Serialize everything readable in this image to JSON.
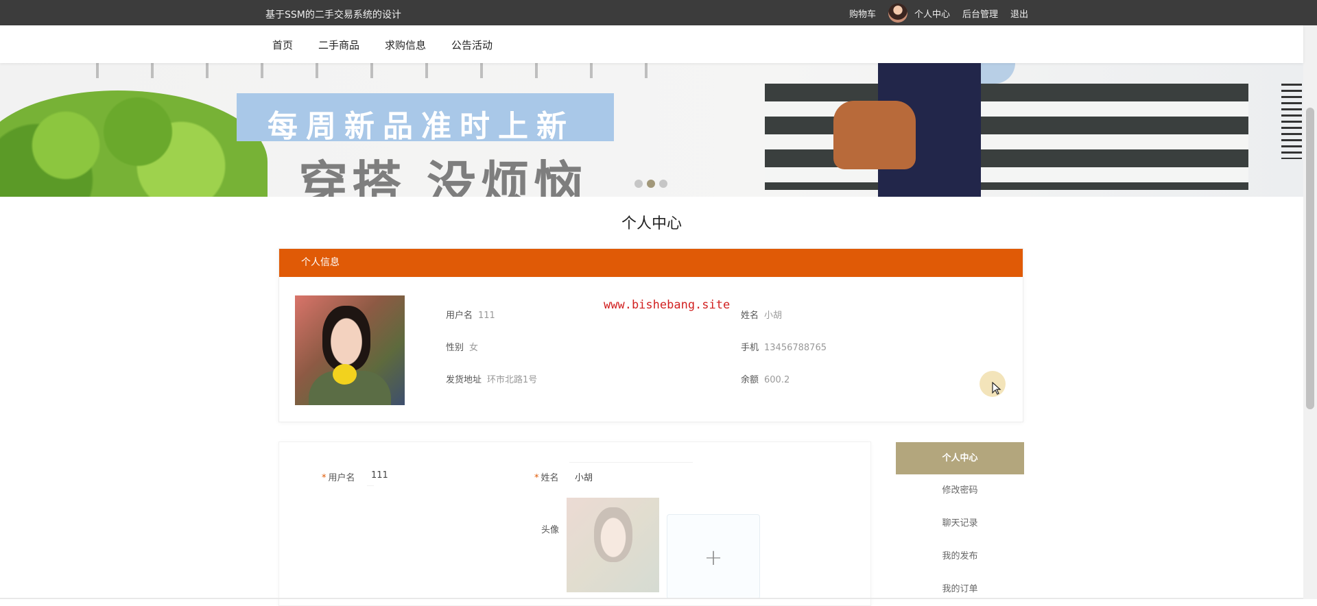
{
  "topbar": {
    "site_title": "基于SSM的二手交易系统的设计",
    "cart": "购物车",
    "user_center": "个人中心",
    "admin": "后台管理",
    "logout": "退出"
  },
  "nav": {
    "items": [
      "首页",
      "二手商品",
      "求购信息",
      "公告活动"
    ]
  },
  "banner": {
    "slogan": "每周新品准时上新",
    "slogan2": "穿搭 没烦恼",
    "active_slide": 2,
    "slide_count": 3
  },
  "page_title": "个人中心",
  "info_card": {
    "header": "个人信息",
    "username_label": "用户名",
    "username": "111",
    "name_label": "姓名",
    "name": "小胡",
    "gender_label": "性别",
    "gender": "女",
    "phone_label": "手机",
    "phone": "13456788765",
    "address_label": "发货地址",
    "address": "环市北路1号",
    "balance_label": "余额",
    "balance": "600.2"
  },
  "watermark": "www.bishebang.site",
  "form": {
    "required_mark": "*",
    "username_label": "用户名",
    "username_value": "111",
    "name_label": "姓名",
    "name_value": "小胡",
    "avatar_label": "头像",
    "upload_symbol": "+"
  },
  "side_menu": {
    "items": [
      "个人中心",
      "修改密码",
      "聊天记录",
      "我的发布",
      "我的订单"
    ],
    "active_index": 0
  },
  "colors": {
    "topbar": "#3c3c3c",
    "header_orange": "#e05a06",
    "menu_active": "#b3a67d",
    "watermark": "#d12020"
  }
}
